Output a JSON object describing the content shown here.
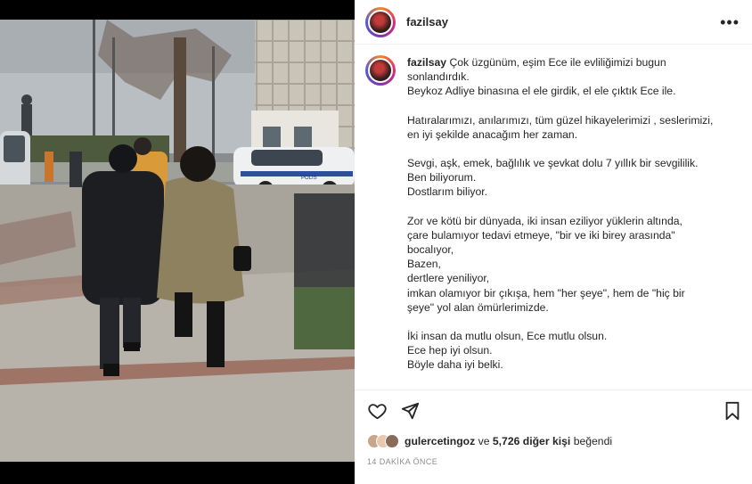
{
  "post": {
    "username": "fazilsay",
    "more_icon": "more-horizontal-icon",
    "caption_paragraphs": [
      [
        "Çok üzgünüm, eşim Ece ile evliliğimizi bugun",
        "sonlandırdık.",
        "Beykoz Adliye binasına el ele girdik, el ele çıktık Ece ile."
      ],
      [
        "Hatıralarımızı, anılarımızı, tüm güzel hikayelerimizi , seslerimizi,",
        "en iyi şekilde anacağım her zaman."
      ],
      [
        "Sevgi, aşk, emek, bağlılık ve şevkat dolu 7 yıllık bir sevgililik.",
        "Ben biliyorum.",
        "Dostlarım biliyor."
      ],
      [
        "Zor ve kötü bir dünyada, iki insan eziliyor yüklerin altında,",
        "çare bulamıyor tedavi etmeye, \"bir ve iki birey arasında\"",
        "bocalıyor,",
        "Bazen,",
        "dertlere yeniliyor,",
        "imkan olamıyor bir çıkışa, hem \"her şeye\", hem de \"hiç bir",
        "şeye\" yol alan ömürlerimizde."
      ],
      [
        "İki insan da mutlu olsun, Ece mutlu olsun.",
        "Ece hep iyi olsun.",
        "Böyle daha iyi belki."
      ]
    ],
    "likes": {
      "first_user": "gulercetingoz",
      "connector": "ve",
      "count_text": "5,726 diğer kişi",
      "suffix": "beğendi"
    },
    "timestamp": "14 DAKİKA ÖNCE",
    "photo_sign_text": "POLİS"
  },
  "colors": {
    "text": "#262626",
    "muted": "#8e8e8e",
    "divider": "#efefef"
  }
}
